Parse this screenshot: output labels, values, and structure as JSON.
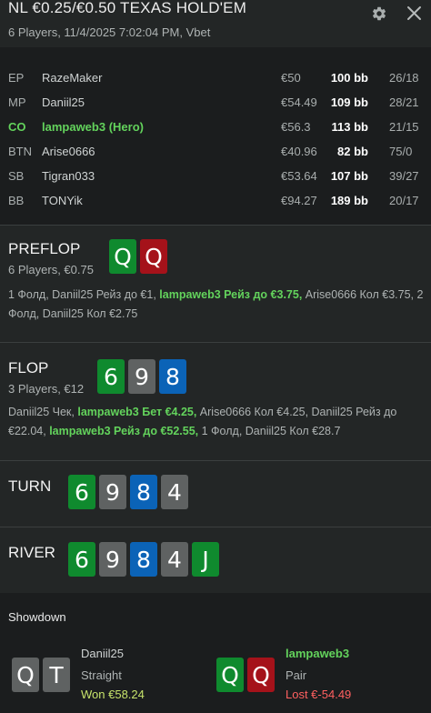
{
  "header": {
    "title": "NL €0.25/€0.50 TEXAS HOLD'EM",
    "subtitle": "6 Players, 11/4/2025 7:02:04 PM, Vbet",
    "settings_icon": "gear-icon",
    "close_icon": "close-icon"
  },
  "players": [
    {
      "pos": "EP",
      "name": "RazeMaker",
      "stack": "€50",
      "bb": "100 bb",
      "stats": "26/18",
      "hero": false
    },
    {
      "pos": "MP",
      "name": "Daniil25",
      "stack": "€54.49",
      "bb": "109 bb",
      "stats": "28/21",
      "hero": false
    },
    {
      "pos": "CO",
      "name": "lampaweb3 (Hero)",
      "stack": "€56.3",
      "bb": "113 bb",
      "stats": "21/15",
      "hero": true
    },
    {
      "pos": "BTN",
      "name": "Arise0666",
      "stack": "€40.96",
      "bb": "82 bb",
      "stats": "75/0",
      "hero": false
    },
    {
      "pos": "SB",
      "name": "Tigran033",
      "stack": "€53.64",
      "bb": "107 bb",
      "stats": "39/27",
      "hero": false
    },
    {
      "pos": "BB",
      "name": "TONYik",
      "stack": "€94.27",
      "bb": "189 bb",
      "stats": "20/17",
      "hero": false
    }
  ],
  "preflop": {
    "name": "PREFLOP",
    "sub": "6 Players, €0.75",
    "cards": [
      {
        "rank": "Q",
        "color": "green"
      },
      {
        "rank": "Q",
        "color": "red"
      }
    ],
    "actions": [
      {
        "text": "1 Фолд, Daniil25 Рейз до €1, ",
        "hero": false
      },
      {
        "text": "lampaweb3 Рейз до €3.75,",
        "hero": true
      },
      {
        "text": " Arise0666 Кол €3.75, 2 Фолд, Daniil25 Кол €2.75",
        "hero": false
      }
    ]
  },
  "flop": {
    "name": "FLOP",
    "sub": "3 Players, €12",
    "cards": [
      {
        "rank": "6",
        "color": "green"
      },
      {
        "rank": "9",
        "color": "gray"
      },
      {
        "rank": "8",
        "color": "blue"
      }
    ],
    "actions": [
      {
        "text": "Daniil25 Чек, ",
        "hero": false
      },
      {
        "text": "lampaweb3 Бет €4.25,",
        "hero": true
      },
      {
        "text": " Arise0666 Кол €4.25, Daniil25 Рейз до €22.04, ",
        "hero": false
      },
      {
        "text": "lampaweb3 Рейз до €52.55,",
        "hero": true
      },
      {
        "text": " 1 Фолд, Daniil25 Кол €28.7",
        "hero": false
      }
    ]
  },
  "turn": {
    "name": "TURN",
    "cards": [
      {
        "rank": "6",
        "color": "green"
      },
      {
        "rank": "9",
        "color": "gray"
      },
      {
        "rank": "8",
        "color": "blue"
      },
      {
        "rank": "4",
        "color": "gray"
      }
    ]
  },
  "river": {
    "name": "RIVER",
    "cards": [
      {
        "rank": "6",
        "color": "green"
      },
      {
        "rank": "9",
        "color": "gray"
      },
      {
        "rank": "8",
        "color": "blue"
      },
      {
        "rank": "4",
        "color": "gray"
      },
      {
        "rank": "J",
        "color": "green"
      }
    ]
  },
  "showdown": {
    "title": "Showdown",
    "players": [
      {
        "name": "Daniil25",
        "hand": "Straight",
        "result": "Won €58.24",
        "won": true,
        "hero": false,
        "cards": [
          {
            "rank": "Q",
            "color": "gray"
          },
          {
            "rank": "T",
            "color": "gray"
          }
        ]
      },
      {
        "name": "lampaweb3",
        "hand": "Pair",
        "result": "Lost €-54.49",
        "won": false,
        "hero": true,
        "cards": [
          {
            "rank": "Q",
            "color": "green"
          },
          {
            "rank": "Q",
            "color": "red"
          }
        ]
      }
    ]
  },
  "colors": {
    "hero": "#63d35c",
    "card_green": "#0f8a2e",
    "card_red": "#a5121a",
    "card_gray": "#5f6262",
    "card_blue": "#0b63b7",
    "won": "#c7e46b",
    "lost": "#ff6060"
  }
}
